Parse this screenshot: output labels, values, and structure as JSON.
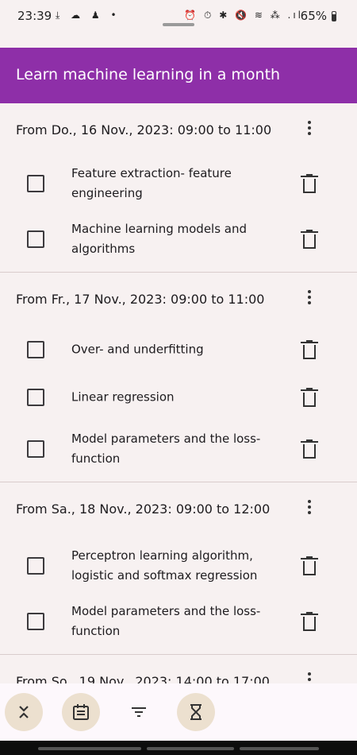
{
  "status_bar": {
    "time": "23:39",
    "left_icons": "⤓ ☁ ♟ •",
    "right_icons": "⏰ ⏱ ✱ 🔇 ≋ ⁂ .ıl",
    "battery": "65%"
  },
  "app_bar": {
    "title": "Learn machine learning in a month",
    "color": "#8e2fa8"
  },
  "sections": [
    {
      "title": "From Do., 16 Nov., 2023: 09:00 to 11:00",
      "tasks": [
        {
          "label": "Feature extraction- feature engineering",
          "checked": false
        },
        {
          "label": "Machine learning models and algorithms",
          "checked": false
        }
      ]
    },
    {
      "title": "From Fr., 17 Nov., 2023: 09:00 to 11:00",
      "tasks": [
        {
          "label": "Over- and underfitting",
          "checked": false
        },
        {
          "label": "Linear regression",
          "checked": false
        },
        {
          "label": "Model parameters and the loss-function",
          "checked": false
        }
      ]
    },
    {
      "title": "From Sa., 18 Nov., 2023: 09:00 to 12:00",
      "tasks": [
        {
          "label": "Perceptron learning algorithm, logistic and softmax regression",
          "checked": false
        },
        {
          "label": "Model parameters and the loss-function",
          "checked": false
        }
      ]
    },
    {
      "title": "From So., 19 Nov., 2023: 14:00 to 17:00",
      "tasks": []
    }
  ],
  "bottom_bar": {
    "actions": [
      {
        "icon": "collapse-icon"
      },
      {
        "icon": "calendar-icon"
      },
      {
        "icon": "filter-icon"
      },
      {
        "icon": "hourglass-icon"
      }
    ]
  }
}
